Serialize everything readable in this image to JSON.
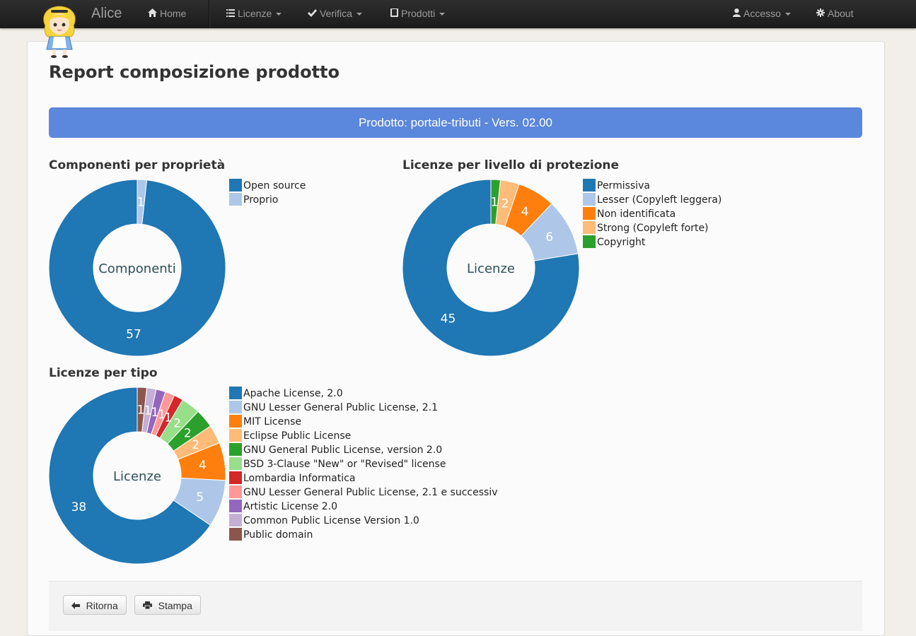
{
  "navbar": {
    "brand": "Alice",
    "home": "Home",
    "licenze": "Licenze",
    "verifica": "Verifica",
    "prodotti": "Prodotti",
    "accesso": "Accesso",
    "about": "About",
    "icons": [
      "home-icon",
      "list-icon",
      "check-icon",
      "book-icon",
      "user-icon",
      "gear-icon"
    ]
  },
  "page": {
    "title": "Report composizione prodotto",
    "product_banner": "Prodotto: portale-tributi - Vers. 02.00"
  },
  "sections": {
    "ownership_title": "Componenti per proprietà",
    "protection_title": "Licenze per livello di protezione",
    "type_title": "Licenze per tipo"
  },
  "chart_data": [
    {
      "type": "pie",
      "id": "ownership",
      "center_label": "Componenti",
      "categories": [
        "Open source",
        "Proprio"
      ],
      "values": [
        57,
        1
      ],
      "colors": [
        "#1f77b4",
        "#aec7e8"
      ]
    },
    {
      "type": "pie",
      "id": "protection",
      "center_label": "Licenze",
      "categories": [
        "Permissiva",
        "Lesser (Copyleft leggera)",
        "Non identificata",
        "Strong (Copyleft forte)",
        "Copyright"
      ],
      "values": [
        45,
        6,
        4,
        2,
        1
      ],
      "colors": [
        "#1f77b4",
        "#aec7e8",
        "#ff7f0e",
        "#ffbb78",
        "#2ca02c"
      ]
    },
    {
      "type": "pie",
      "id": "type",
      "center_label": "Licenze",
      "categories": [
        "Apache License, 2.0",
        "GNU Lesser General Public License, 2.1",
        "MIT License",
        "Eclipse Public License",
        "GNU General Public License, version 2.0",
        "BSD 3-Clause \"New\" or \"Revised\" license",
        "Lombardia Informatica",
        "GNU Lesser General Public License, 2.1 e successiv",
        "Artistic License 2.0",
        "Common Public License Version 1.0",
        "Public domain"
      ],
      "values": [
        38,
        5,
        4,
        2,
        2,
        2,
        1,
        1,
        1,
        1,
        1
      ],
      "colors": [
        "#1f77b4",
        "#aec7e8",
        "#ff7f0e",
        "#ffbb78",
        "#2ca02c",
        "#98df8a",
        "#d62728",
        "#ff9896",
        "#9467bd",
        "#c5b0d5",
        "#8c564b"
      ]
    }
  ],
  "buttons": {
    "back": "Ritorna",
    "print": "Stampa"
  }
}
